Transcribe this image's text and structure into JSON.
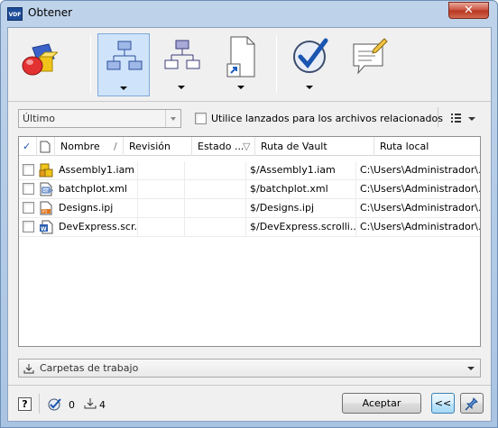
{
  "window": {
    "title": "Obtener",
    "app_icon_label": "VDF",
    "close_symbol": "✕"
  },
  "toolbar": {
    "buttons": [
      {
        "name": "shapes-icon",
        "has_dropdown": false
      },
      {
        "name": "hierarchy-icon",
        "has_dropdown": true,
        "active": true
      },
      {
        "name": "hierarchy-alt-icon",
        "has_dropdown": true
      },
      {
        "name": "document-shortcut-icon",
        "has_dropdown": true
      },
      {
        "name": "checkmark-icon",
        "has_dropdown": true
      },
      {
        "name": "comment-edit-icon",
        "has_dropdown": false
      }
    ]
  },
  "options": {
    "version_value": "Último",
    "launch_checkbox_label": "Utilice lanzados para los archivos relacionados",
    "launch_checked": false
  },
  "grid": {
    "columns": {
      "check": "✓",
      "name": "Nombre",
      "revision": "Revisión",
      "state": "Estado ...",
      "vault_path": "Ruta de Vault",
      "local_path": "Ruta local"
    },
    "rows": [
      {
        "name": "Assembly1.iam",
        "revision": "",
        "state": "",
        "vault_path": "$/Assembly1.iam",
        "local_path": "C:\\Users\\Administrador\\...",
        "icon": "assembly-file-icon",
        "checked": false
      },
      {
        "name": "batchplot.xml",
        "revision": "",
        "state": "",
        "vault_path": "$/batchplot.xml",
        "local_path": "C:\\Users\\Administrador\\...",
        "icon": "xml-file-icon",
        "checked": false
      },
      {
        "name": "Designs.ipj",
        "revision": "",
        "state": "",
        "vault_path": "$/Designs.ipj",
        "local_path": "C:\\Users\\Administrador\\...",
        "icon": "ipj-file-icon",
        "checked": false
      },
      {
        "name": "DevExpress.scr...",
        "revision": "",
        "state": "",
        "vault_path": "$/DevExpress.scrolli...",
        "local_path": "C:\\Users\\Administrador\\...",
        "icon": "word-file-icon",
        "checked": false
      }
    ]
  },
  "workspace": {
    "label": "Carpetas de trabajo"
  },
  "footer": {
    "help": "?",
    "checked_count": "0",
    "download_count": "4",
    "accept_label": "Aceptar",
    "collapse_label": "<<"
  },
  "colors": {
    "accent": "#1a55b0",
    "title_bar": "#bfd3ea"
  }
}
